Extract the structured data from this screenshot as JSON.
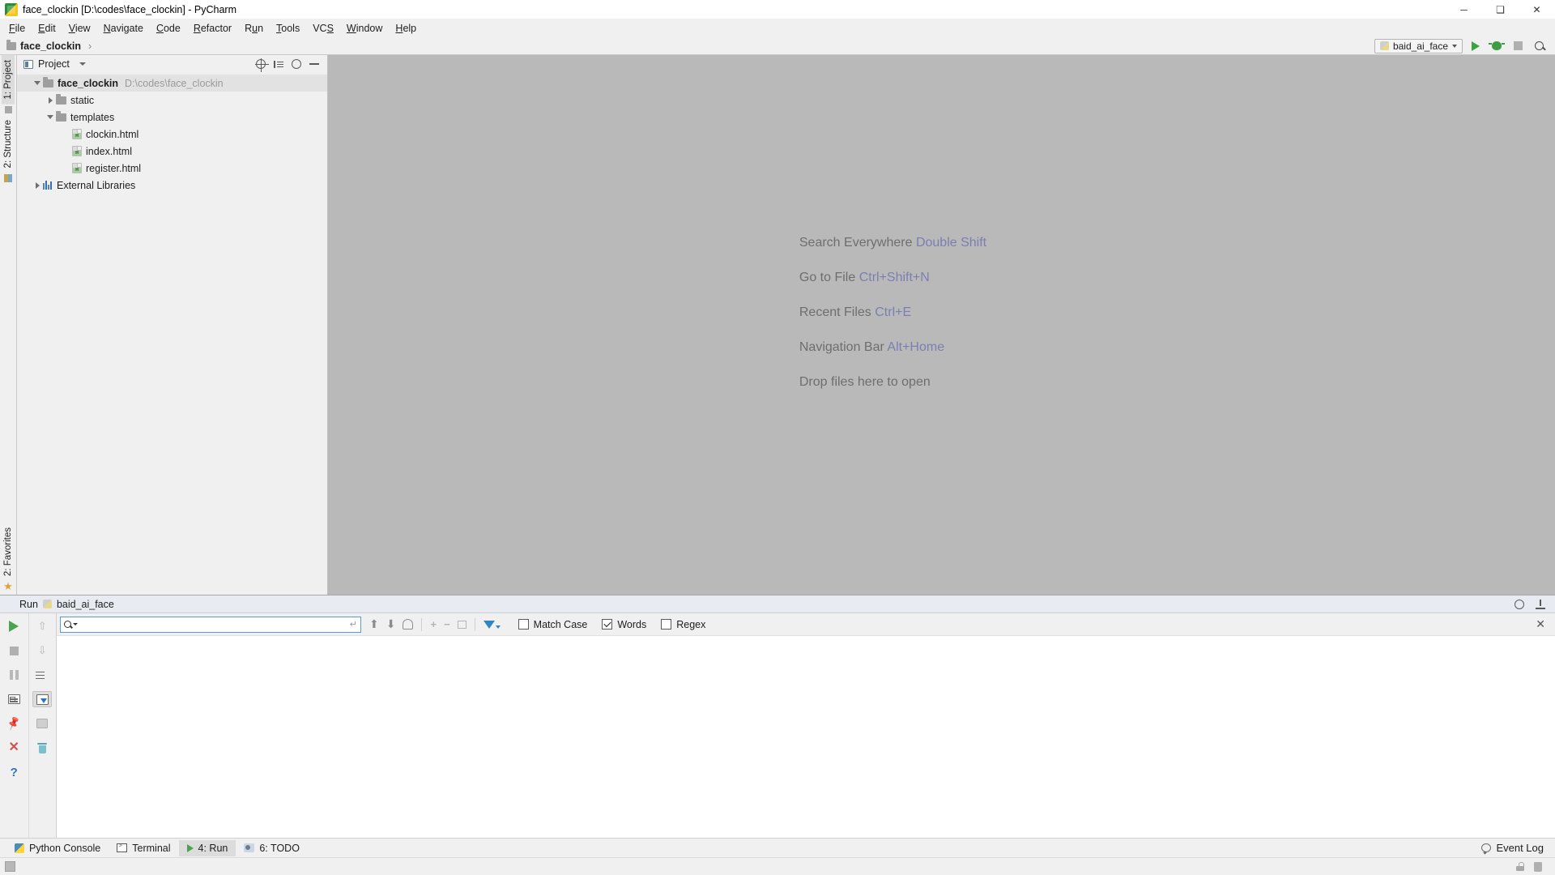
{
  "window": {
    "title": "face_clockin [D:\\codes\\face_clockin] - PyCharm",
    "app_icon": "pycharm-icon",
    "minimize": "─",
    "maximize": "❑",
    "close": "✕"
  },
  "menubar": {
    "items": [
      {
        "label": "File",
        "mnemonic": "F"
      },
      {
        "label": "Edit",
        "mnemonic": "E"
      },
      {
        "label": "View",
        "mnemonic": "V"
      },
      {
        "label": "Navigate",
        "mnemonic": "N"
      },
      {
        "label": "Code",
        "mnemonic": "C"
      },
      {
        "label": "Refactor",
        "mnemonic": "R"
      },
      {
        "label": "Run",
        "mnemonic": "u"
      },
      {
        "label": "Tools",
        "mnemonic": "T"
      },
      {
        "label": "VCS",
        "mnemonic": "S"
      },
      {
        "label": "Window",
        "mnemonic": "W"
      },
      {
        "label": "Help",
        "mnemonic": "H"
      }
    ]
  },
  "navbar": {
    "breadcrumb": "face_clockin",
    "separator": "›",
    "run_config": "baid_ai_face",
    "buttons": [
      "run-button",
      "debug-button",
      "stop-button",
      "search-button"
    ]
  },
  "left_rail": {
    "top_tabs": [
      {
        "label": "1: Project",
        "active": true
      },
      {
        "label": "2: Structure",
        "active": false
      }
    ],
    "bottom_tabs": [
      {
        "label": "2: Favorites",
        "active": false
      }
    ]
  },
  "project_panel": {
    "title": "Project",
    "actions": [
      "locate-icon",
      "collapse-all-icon",
      "settings-icon",
      "hide-icon"
    ],
    "tree": [
      {
        "label": "face_clockin",
        "path": "D:\\codes\\face_clockin",
        "icon": "folder-icon",
        "depth": 0,
        "expanded": true,
        "bold": true,
        "selected": true
      },
      {
        "label": "static",
        "path": "",
        "icon": "folder-icon",
        "depth": 1,
        "expanded": false,
        "bold": false,
        "selected": false
      },
      {
        "label": "templates",
        "path": "",
        "icon": "folder-icon",
        "depth": 1,
        "expanded": true,
        "bold": false,
        "selected": false
      },
      {
        "label": "clockin.html",
        "path": "",
        "icon": "html-file-icon",
        "depth": 2,
        "expanded": null,
        "bold": false,
        "selected": false
      },
      {
        "label": "index.html",
        "path": "",
        "icon": "html-file-icon",
        "depth": 2,
        "expanded": null,
        "bold": false,
        "selected": false
      },
      {
        "label": "register.html",
        "path": "",
        "icon": "html-file-icon",
        "depth": 2,
        "expanded": null,
        "bold": false,
        "selected": false
      },
      {
        "label": "External Libraries",
        "path": "",
        "icon": "libraries-icon",
        "depth": 0,
        "expanded": false,
        "bold": false,
        "selected": false
      }
    ]
  },
  "editor": {
    "tips": [
      {
        "text": "Search Everywhere",
        "key": "Double Shift"
      },
      {
        "text": "Go to File",
        "key": "Ctrl+Shift+N"
      },
      {
        "text": "Recent Files",
        "key": "Ctrl+E"
      },
      {
        "text": "Navigation Bar",
        "key": "Alt+Home"
      },
      {
        "text": "Drop files here to open",
        "key": ""
      }
    ]
  },
  "run_window": {
    "header_label": "Run",
    "config_name": "baid_ai_face",
    "header_actions": [
      "settings-icon",
      "hide-icon"
    ],
    "toolbar_left": [
      {
        "name": "rerun-button"
      },
      {
        "name": "stop-button"
      },
      {
        "name": "pause-output-button"
      },
      {
        "name": "console-button"
      },
      {
        "name": "pin-tab-button"
      },
      {
        "name": "close-button"
      },
      {
        "name": "help-button"
      }
    ],
    "toolbar_right": [
      {
        "name": "up-the-stack-button"
      },
      {
        "name": "down-the-stack-button"
      },
      {
        "name": "soft-wrap-button"
      },
      {
        "name": "scroll-to-end-button"
      },
      {
        "name": "print-button"
      },
      {
        "name": "clear-all-button"
      }
    ],
    "find": {
      "value": "",
      "placeholder": "",
      "search_icon": "search-icon",
      "enter_icon": "enter-icon",
      "nav_buttons": [
        "prev-occurrence-button",
        "next-occurrence-button",
        "select-all-button"
      ],
      "extra_buttons": [
        "add-line-button",
        "remove-line-button",
        "copy-lines-button"
      ],
      "filter_button": "filter-icon",
      "checkboxes": [
        {
          "label": "Match Case",
          "mnemonic": "C",
          "checked": false
        },
        {
          "label": "Words",
          "mnemonic": "",
          "checked": true
        },
        {
          "label": "Regex",
          "mnemonic": "",
          "checked": false
        }
      ],
      "close_label": "✕"
    },
    "output": ""
  },
  "statusbar": {
    "tabs": [
      {
        "label": "Python Console",
        "icon": "python-icon",
        "active": false
      },
      {
        "label": "Terminal",
        "icon": "terminal-icon",
        "active": false
      },
      {
        "label": "4: Run",
        "icon": "run-icon",
        "active": true
      },
      {
        "label": "6: TODO",
        "icon": "todo-icon",
        "active": false
      }
    ],
    "event_log": "Event Log",
    "event_log_icon": "bubble-icon"
  },
  "bottom_strip": {
    "left_icon": "memory-indicator",
    "right_icons": [
      "lock-icon",
      "bin-icon"
    ]
  },
  "colors": {
    "accent_blue": "#5b9bd5",
    "link": "#7b7fb0",
    "editor_bg": "#b9b9b9",
    "panel_bg": "#f0f0f0",
    "run_header_bg": "#e8ecf2",
    "green": "#4aa44f"
  }
}
